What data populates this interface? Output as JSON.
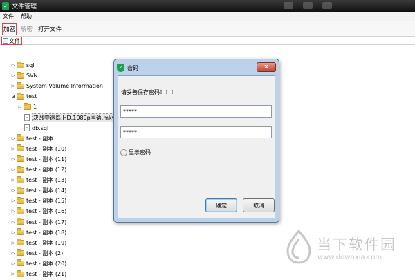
{
  "window": {
    "title": "文件管理"
  },
  "menu": [
    "文件",
    "帮助"
  ],
  "toolbar": {
    "encrypt": "加密",
    "decrypt": "解密",
    "open_file": "打开文件"
  },
  "tab": {
    "label": "文件"
  },
  "tree": [
    {
      "label": "sql",
      "type": "folder",
      "indent": 0,
      "expander": "▷"
    },
    {
      "label": "SVN",
      "type": "folder",
      "indent": 0,
      "expander": "▷"
    },
    {
      "label": "System Volume Information",
      "type": "folder",
      "indent": 0,
      "expander": "▷"
    },
    {
      "label": "test",
      "type": "folder",
      "indent": 0,
      "expander": "◢"
    },
    {
      "label": "1",
      "type": "folder",
      "indent": 1,
      "expander": "▷"
    },
    {
      "label": "决战中途岛.HD.1080p国语.mkv",
      "type": "file",
      "indent": 1,
      "expander": "",
      "selected": true
    },
    {
      "label": "db.sql",
      "type": "file",
      "indent": 1,
      "expander": ""
    },
    {
      "label": "test - 副本",
      "type": "folder",
      "indent": 0,
      "expander": "▷"
    },
    {
      "label": "test - 副本 (10)",
      "type": "folder",
      "indent": 0,
      "expander": "▷"
    },
    {
      "label": "test - 副本 (11)",
      "type": "folder",
      "indent": 0,
      "expander": "▷"
    },
    {
      "label": "test - 副本 (12)",
      "type": "folder",
      "indent": 0,
      "expander": "▷"
    },
    {
      "label": "test - 副本 (13)",
      "type": "folder",
      "indent": 0,
      "expander": "▷"
    },
    {
      "label": "test - 副本 (14)",
      "type": "folder",
      "indent": 0,
      "expander": "▷"
    },
    {
      "label": "test - 副本 (15)",
      "type": "folder",
      "indent": 0,
      "expander": "▷"
    },
    {
      "label": "test - 副本 (16)",
      "type": "folder",
      "indent": 0,
      "expander": "▷"
    },
    {
      "label": "test - 副本 (17)",
      "type": "folder",
      "indent": 0,
      "expander": "▷"
    },
    {
      "label": "test - 副本 (18)",
      "type": "folder",
      "indent": 0,
      "expander": "▷"
    },
    {
      "label": "test - 副本 (19)",
      "type": "folder",
      "indent": 0,
      "expander": "▷"
    },
    {
      "label": "test - 副本 (2)",
      "type": "folder",
      "indent": 0,
      "expander": "▷"
    },
    {
      "label": "test - 副本 (20)",
      "type": "folder",
      "indent": 0,
      "expander": "▷"
    },
    {
      "label": "test - 副本 (21)",
      "type": "folder",
      "indent": 0,
      "expander": "▷"
    }
  ],
  "dialog": {
    "title": "密码",
    "close": "x",
    "prompt": "请妥善保存密码！！！",
    "password_value": "*****",
    "confirm_value": "*****",
    "show_password": "显示密码",
    "ok": "确定",
    "cancel": "取消"
  },
  "watermark": {
    "name": "当下软件园",
    "url": "www.downxia.com"
  },
  "colors": {
    "app_icon": "#1aa14f",
    "highlight_border": "#e34040",
    "dialog_frame": "#bcd2ea"
  }
}
